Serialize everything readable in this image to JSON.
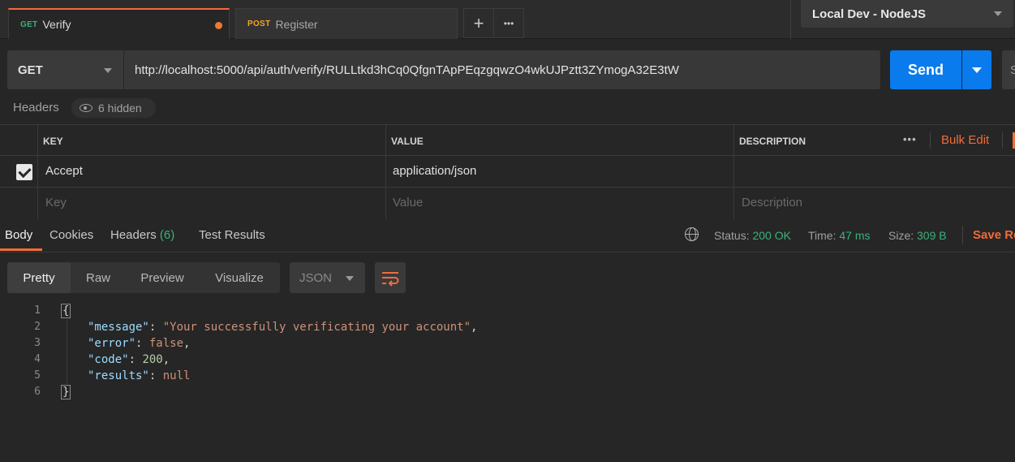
{
  "tabs": [
    {
      "method": "GET",
      "name": "Verify",
      "method_color": "#3ab27a"
    },
    {
      "method": "POST",
      "name": "Register",
      "method_color": "#f5a623"
    }
  ],
  "tab_actions": {
    "add": "+",
    "more": "•••"
  },
  "environment": {
    "selected": "Local Dev - NodeJS"
  },
  "request": {
    "method": "GET",
    "url": "http://localhost:5000/api/auth/verify/RULLtkd3hCq0QfgnTApPEqzgqwzO4wkUJPztt3ZYmogA32E3tW",
    "send_label": "Send",
    "save_label": "S"
  },
  "headers_section": {
    "title": "Headers",
    "hidden_count": "6 hidden",
    "columns": {
      "key": "KEY",
      "value": "VALUE",
      "description": "DESCRIPTION"
    },
    "more": "•••",
    "bulk_edit": "Bulk Edit",
    "rows": [
      {
        "key": "Accept",
        "value": "application/json",
        "checked": true
      }
    ],
    "placeholders": {
      "key": "Key",
      "value": "Value",
      "description": "Description"
    }
  },
  "response": {
    "tabs": {
      "body": "Body",
      "cookies": "Cookies",
      "headers": "Headers",
      "headers_count": "(6)",
      "tests": "Test Results"
    },
    "status_label": "Status:",
    "status_value": "200 OK",
    "time_label": "Time:",
    "time_value": "47 ms",
    "size_label": "Size:",
    "size_value": "309 B",
    "save_label": "Save Re"
  },
  "view": {
    "modes": [
      "Pretty",
      "Raw",
      "Preview",
      "Visualize"
    ],
    "format": "JSON"
  },
  "body_lines": {
    "n1": "1",
    "n2": "2",
    "n3": "3",
    "n4": "4",
    "n5": "5",
    "n6": "6",
    "open": "{",
    "close": "}",
    "k_message": "\"message\"",
    "v_message": "\"Your successfully verificating your account\"",
    "k_error": "\"error\"",
    "v_error": "false",
    "k_code": "\"code\"",
    "v_code": "200",
    "k_results": "\"results\"",
    "v_results": "null"
  }
}
